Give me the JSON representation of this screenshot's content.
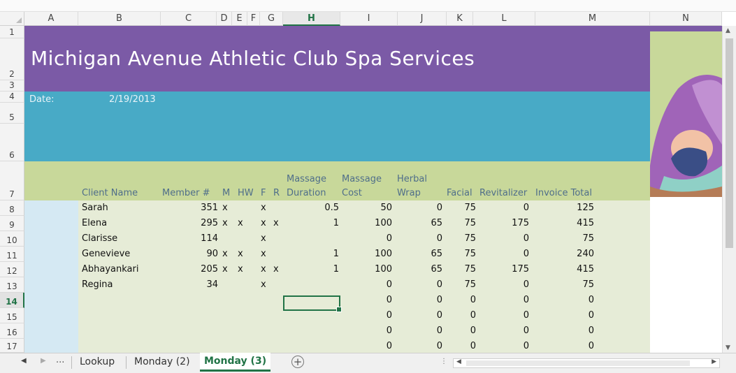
{
  "column_headers": [
    "A",
    "B",
    "C",
    "D",
    "E",
    "F",
    "G",
    "H",
    "I",
    "J",
    "K",
    "L",
    "M",
    "N"
  ],
  "row_headers": [
    "1",
    "2",
    "3",
    "4",
    "5",
    "6",
    "7",
    "8",
    "9",
    "10",
    "11",
    "12",
    "13",
    "14",
    "15",
    "16",
    "17"
  ],
  "title": "Michigan Avenue Athletic Club Spa Services",
  "date_label": "Date:",
  "date_value": "2/19/2013",
  "headers": {
    "client_name": "Client Name",
    "member": "Member #",
    "m": "M",
    "hw": "HW",
    "f": "F",
    "r": "R",
    "massage_duration_1": "Massage",
    "massage_duration_2": "Duration",
    "massage_cost_1": "Massage",
    "massage_cost_2": "Cost",
    "herbal_wrap_1": "Herbal",
    "herbal_wrap_2": "Wrap",
    "facial": "Facial",
    "revitalizer": "Revitalizer",
    "invoice_total": "Invoice Total"
  },
  "rows": [
    {
      "name": "Sarah",
      "member": "351",
      "m": "x",
      "hw": "",
      "f": "x",
      "r": "",
      "duration": "0.5",
      "mcost": "50",
      "herbal": "0",
      "facial": "75",
      "revit": "0",
      "total": "125"
    },
    {
      "name": "Elena",
      "member": "295",
      "m": "x",
      "hw": "x",
      "f": "x",
      "r": "x",
      "duration": "1",
      "mcost": "100",
      "herbal": "65",
      "facial": "75",
      "revit": "175",
      "total": "415"
    },
    {
      "name": "Clarisse",
      "member": "114",
      "m": "",
      "hw": "",
      "f": "x",
      "r": "",
      "duration": "",
      "mcost": "0",
      "herbal": "0",
      "facial": "75",
      "revit": "0",
      "total": "75"
    },
    {
      "name": "Genevieve",
      "member": "90",
      "m": "x",
      "hw": "x",
      "f": "x",
      "r": "",
      "duration": "1",
      "mcost": "100",
      "herbal": "65",
      "facial": "75",
      "revit": "0",
      "total": "240"
    },
    {
      "name": "Abhayankari",
      "member": "205",
      "m": "x",
      "hw": "x",
      "f": "x",
      "r": "x",
      "duration": "1",
      "mcost": "100",
      "herbal": "65",
      "facial": "75",
      "revit": "175",
      "total": "415"
    },
    {
      "name": "Regina",
      "member": "34",
      "m": "",
      "hw": "",
      "f": "x",
      "r": "",
      "duration": "",
      "mcost": "0",
      "herbal": "0",
      "facial": "75",
      "revit": "0",
      "total": "75"
    },
    {
      "name": "",
      "member": "",
      "m": "",
      "hw": "",
      "f": "",
      "r": "",
      "duration": "",
      "mcost": "0",
      "herbal": "0",
      "facial": "0",
      "revit": "0",
      "total": "0"
    },
    {
      "name": "",
      "member": "",
      "m": "",
      "hw": "",
      "f": "",
      "r": "",
      "duration": "",
      "mcost": "0",
      "herbal": "0",
      "facial": "0",
      "revit": "0",
      "total": "0"
    },
    {
      "name": "",
      "member": "",
      "m": "",
      "hw": "",
      "f": "",
      "r": "",
      "duration": "",
      "mcost": "0",
      "herbal": "0",
      "facial": "0",
      "revit": "0",
      "total": "0"
    },
    {
      "name": "",
      "member": "",
      "m": "",
      "hw": "",
      "f": "",
      "r": "",
      "duration": "",
      "mcost": "0",
      "herbal": "0",
      "facial": "0",
      "revit": "0",
      "total": "0"
    }
  ],
  "tabs": {
    "ellipsis": "...",
    "items": [
      "Lookup",
      "Monday (2)",
      "Monday (3)"
    ],
    "active": "Monday (3)",
    "add": "+"
  },
  "colors": {
    "purple": "#7b5aa6",
    "teal": "#48aac6",
    "green_header": "#c8d89a",
    "pale_green": "#e6ecd7",
    "pale_blue": "#d5e9f3",
    "accent": "#217346"
  }
}
